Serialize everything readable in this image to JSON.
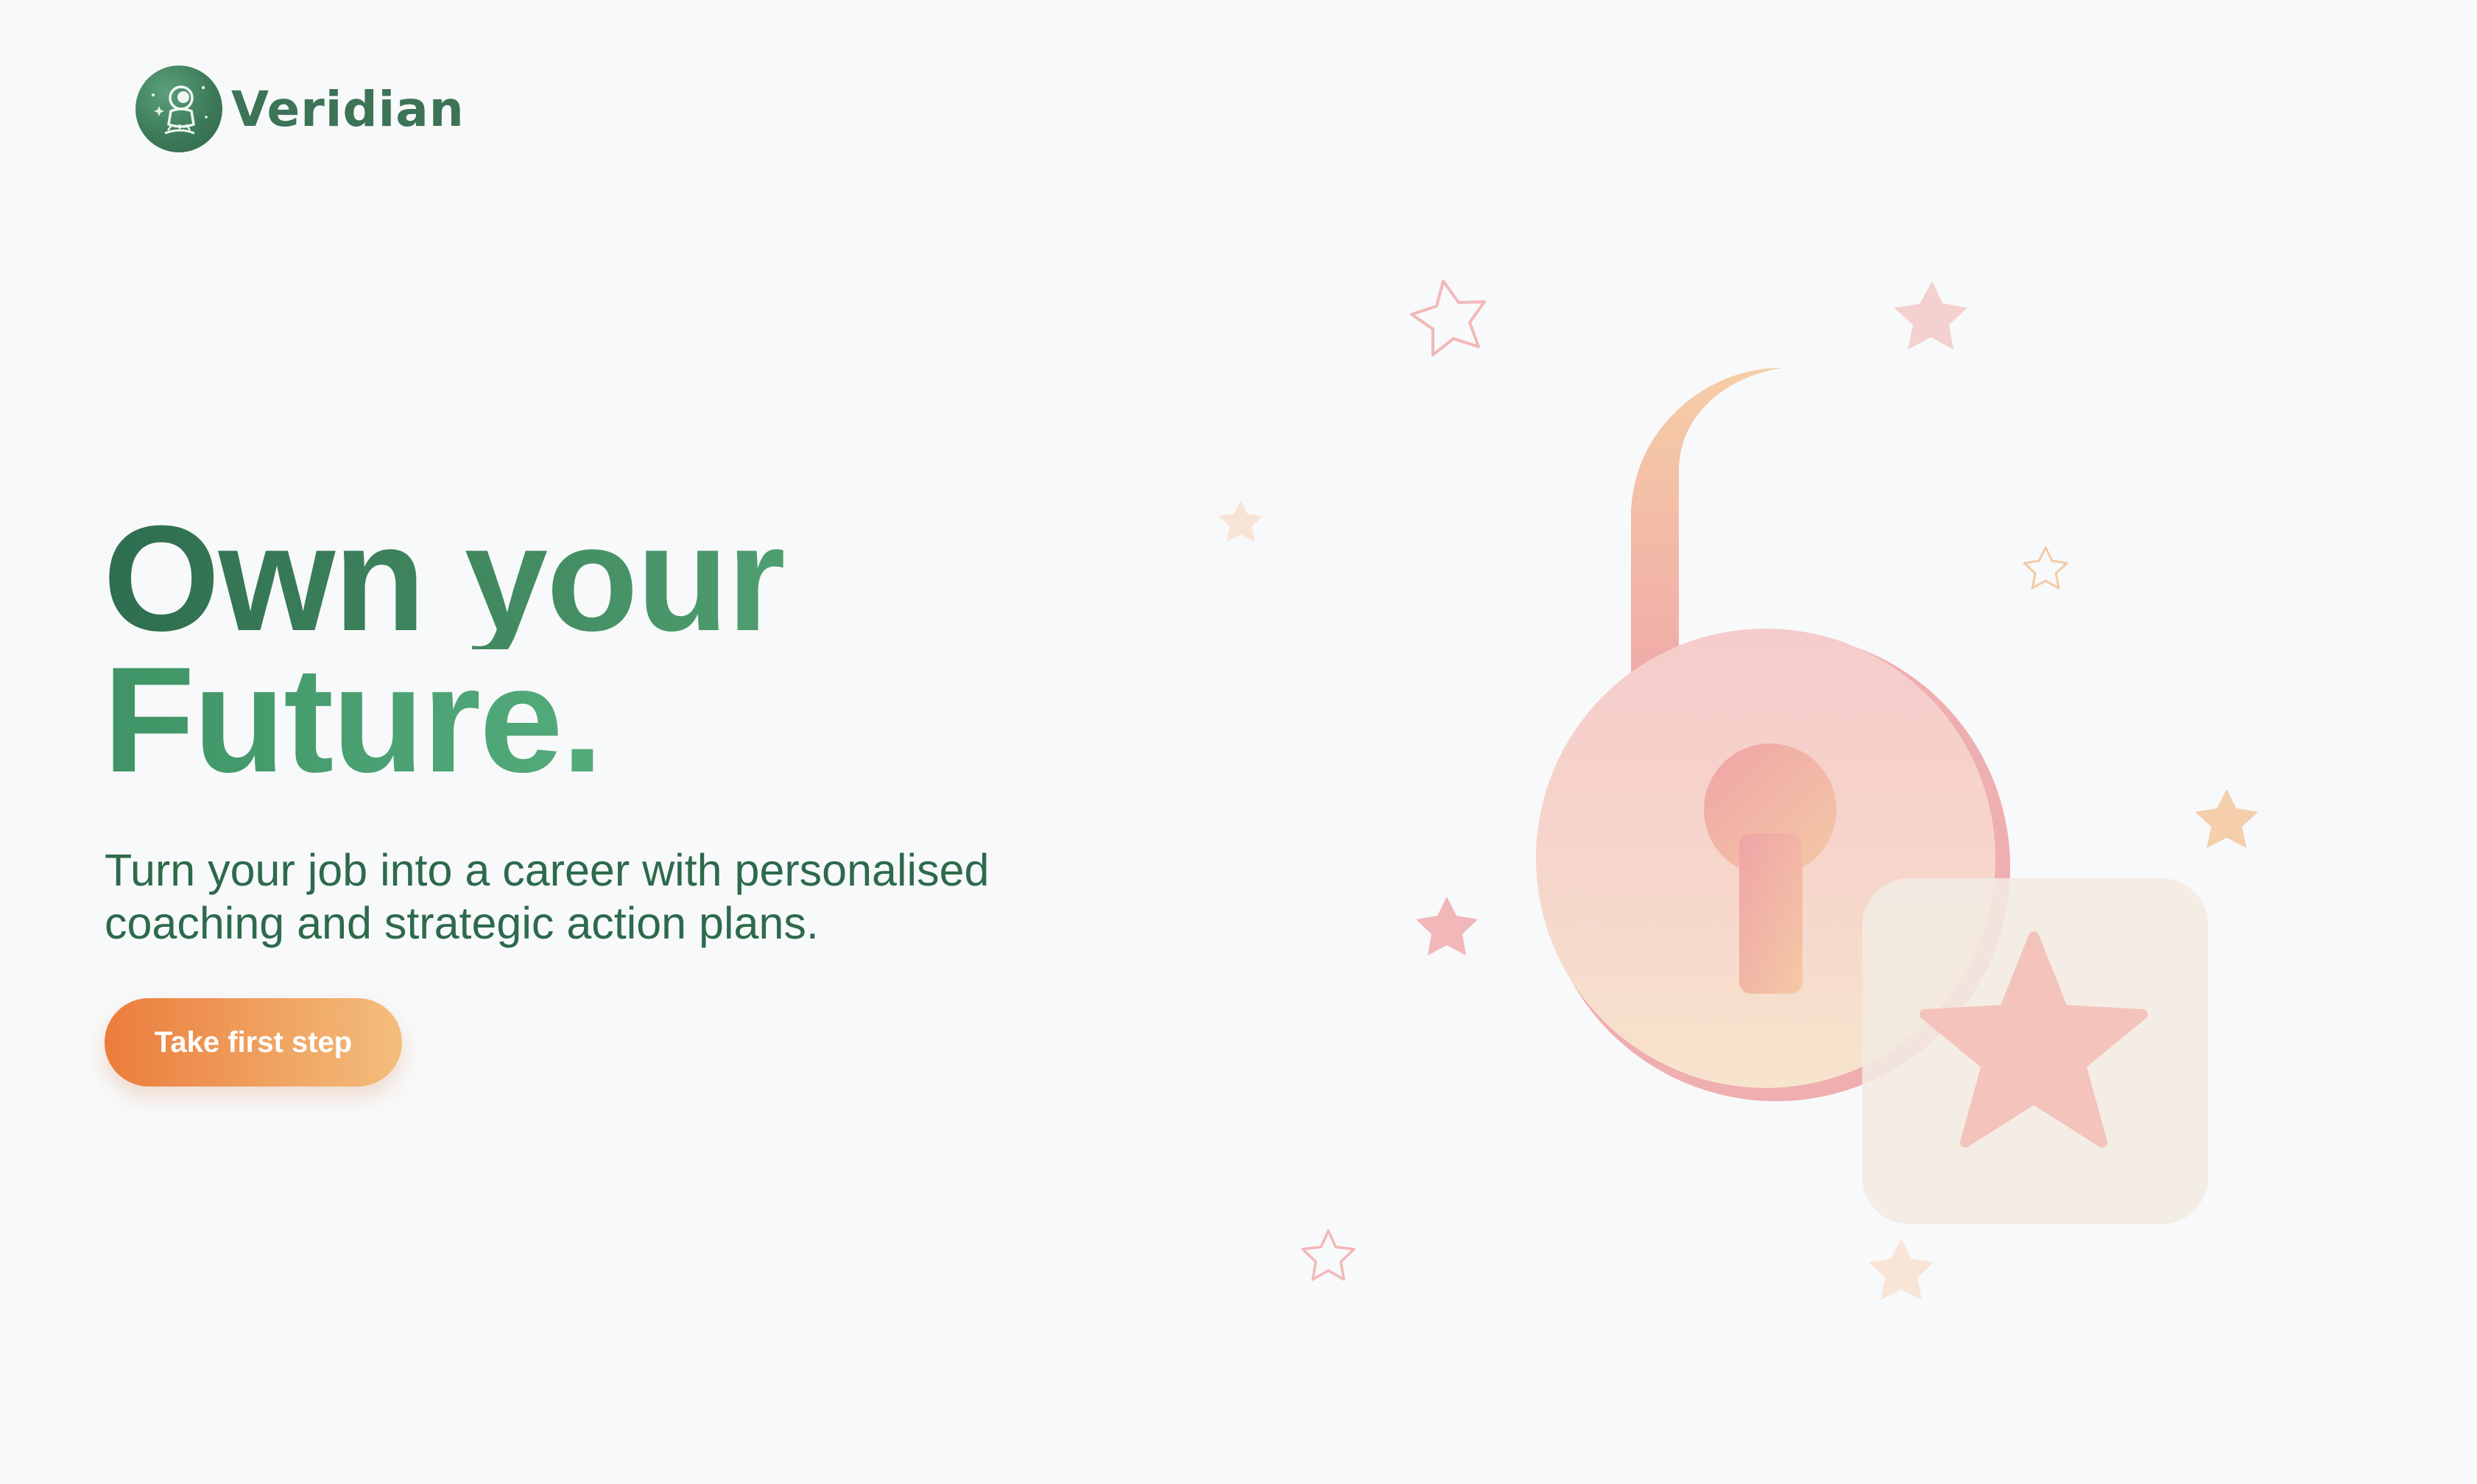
{
  "brand": {
    "name": "Veridian",
    "logo_icon": "astronaut-icon"
  },
  "hero": {
    "headline_line1": "Own your",
    "headline_line2": "Future.",
    "subtitle": "Turn your job into a career with personalised coaching and strategic action plans.",
    "cta_label": "Take first step"
  },
  "illustration": {
    "icons": [
      "unlocked-padlock-icon",
      "star-badge-icon",
      "star-icon"
    ]
  },
  "colors": {
    "background": "#f8f9fa",
    "brand_green": "#3d7357",
    "headline_green_dark": "#2e6d50",
    "headline_green_light": "#5bb383",
    "text_green": "#2d6a4c",
    "cta_orange_start": "#eb7c3c",
    "cta_orange_end": "#f4bd7d",
    "lock_pink": "#f1b0ae",
    "lock_peach": "#f5d8b8"
  }
}
